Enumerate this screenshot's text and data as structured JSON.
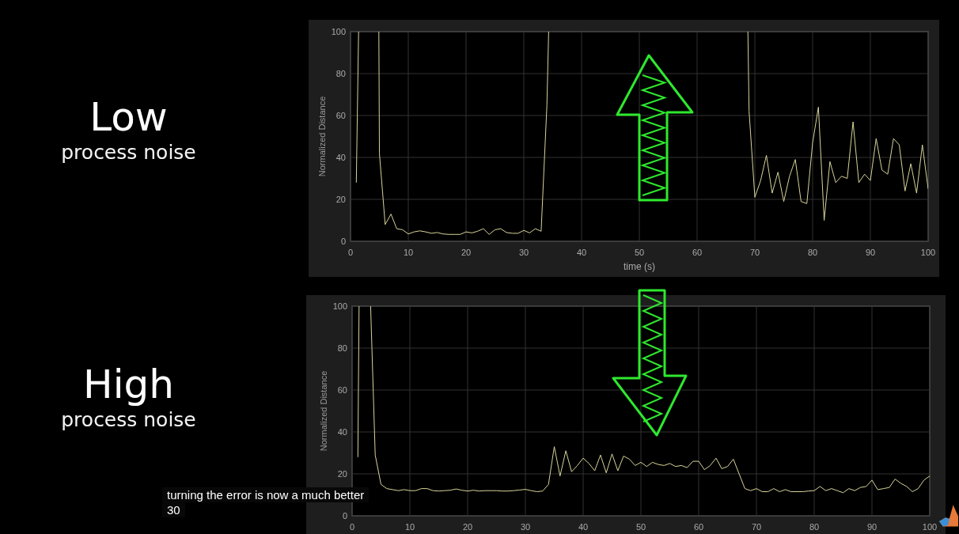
{
  "labels": [
    {
      "level_word": "Low",
      "caption": "process noise"
    },
    {
      "level_word": "High",
      "caption": "process noise"
    }
  ],
  "charts": [
    {
      "chart_data": {
        "type": "line",
        "grid": true,
        "xlabel": "time (s)",
        "ylabel": "Normalized Distance",
        "xlim": [
          0,
          100
        ],
        "ylim": [
          0,
          100
        ],
        "xticks": [
          0,
          10,
          20,
          30,
          40,
          50,
          60,
          70,
          80,
          90,
          100
        ],
        "yticks": [
          0,
          20,
          40,
          60,
          80,
          100
        ],
        "x": [
          1,
          1.4,
          4.9,
          5,
          6,
          7,
          8,
          9,
          10,
          11,
          12,
          13,
          14,
          15,
          16,
          17,
          18,
          19,
          20,
          21,
          22,
          23,
          24,
          25,
          26,
          27,
          28,
          29,
          30,
          31,
          32,
          33,
          34,
          34.3,
          68.8,
          69,
          70,
          71,
          72,
          73,
          74,
          75,
          76,
          77,
          78,
          79,
          80,
          81,
          82,
          83,
          84,
          85,
          86,
          87,
          88,
          89,
          90,
          91,
          92,
          93,
          94,
          95,
          96,
          97,
          98,
          99,
          100
        ],
        "series": [
          {
            "color": "#d8d49a",
            "values": [
              28,
              100,
              100,
              42,
              8,
              13,
              6,
              5.5,
              3.5,
              4.5,
              5,
              4.5,
              3.8,
              4.2,
              3.5,
              3.3,
              3.3,
              3.3,
              4.5,
              4,
              4.8,
              6,
              3.3,
              5.5,
              6,
              4.2,
              3.8,
              3.8,
              5.2,
              4,
              6,
              4.8,
              65,
              100,
              100,
              62,
              21,
              29,
              41,
              23,
              33,
              19,
              31,
              39,
              19,
              18,
              47,
              64,
              10,
              38,
              28,
              31,
              30,
              57,
              28,
              32,
              29,
              49,
              34,
              32,
              49,
              46,
              24,
              37,
              23,
              46,
              25
            ]
          }
        ]
      }
    },
    {
      "chart_data": {
        "type": "line",
        "grid": true,
        "ylabel": "Normalized Distance",
        "xlim": [
          0,
          100
        ],
        "ylim": [
          0,
          100
        ],
        "xticks": [
          0,
          10,
          20,
          30,
          40,
          50,
          60,
          70,
          80,
          90,
          100
        ],
        "yticks": [
          0,
          20,
          40,
          60,
          80,
          100
        ],
        "x": [
          1,
          1.2,
          3.2,
          4,
          5,
          6,
          7,
          8,
          9,
          10,
          11,
          12,
          13,
          14,
          15,
          16,
          17,
          18,
          19,
          20,
          21,
          22,
          23,
          24,
          25,
          26,
          27,
          28,
          29,
          30,
          31,
          32,
          33,
          34,
          35,
          36,
          37,
          38,
          39,
          40,
          41,
          42,
          43,
          44,
          45,
          46,
          47,
          48,
          49,
          50,
          51,
          52,
          53,
          54,
          55,
          56,
          57,
          58,
          59,
          60,
          61,
          62,
          63,
          64,
          65,
          66,
          67,
          68,
          69,
          70,
          71,
          72,
          73,
          74,
          75,
          76,
          77,
          78,
          79,
          80,
          81,
          82,
          83,
          84,
          85,
          86,
          87,
          88,
          89,
          90,
          91,
          92,
          93,
          94,
          95,
          96,
          97,
          98,
          99,
          100
        ],
        "series": [
          {
            "color": "#d8d49a",
            "values": [
              28,
              100,
              100,
              29,
              15,
              13,
              12.5,
              12,
              12.5,
              12,
              12,
              13,
              13,
              12,
              11.8,
              12,
              12.2,
              12.8,
              12.2,
              11.8,
              12.2,
              11.8,
              12,
              12,
              12,
              11.8,
              11.8,
              12,
              12.3,
              12.6,
              12,
              11.5,
              11.8,
              15,
              33,
              19,
              31,
              21,
              24,
              27.5,
              25,
              21.5,
              29,
              20.5,
              29.5,
              21.5,
              28.5,
              27,
              24,
              25.5,
              23.5,
              25.5,
              24.5,
              24,
              25,
              23.5,
              24,
              23,
              26,
              26,
              22,
              24,
              27.5,
              22.5,
              23.5,
              27,
              20,
              13,
              12,
              13,
              11.5,
              11.5,
              13,
              11.5,
              12.5,
              11.5,
              11.5,
              11.5,
              11.8,
              12,
              14,
              12,
              13,
              12,
              11,
              13,
              12,
              13.5,
              14,
              17,
              12.5,
              13,
              13.5,
              17.5,
              15.5,
              14,
              11.5,
              13,
              17,
              19
            ]
          }
        ]
      }
    }
  ],
  "subtitles": [
    "turning the error is now a much better",
    "30"
  ]
}
